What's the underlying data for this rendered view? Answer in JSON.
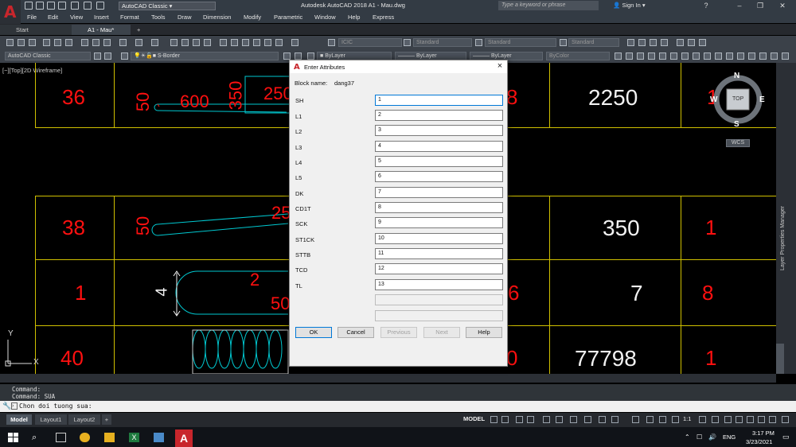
{
  "titlebar": {
    "workspace": "AutoCAD Classic",
    "title": "Autodesk AutoCAD 2018    A1 - Mau.dwg",
    "search_placeholder": "Type a keyword or phrase",
    "signin": "Sign In",
    "help": "?"
  },
  "menu": [
    "File",
    "Edit",
    "View",
    "Insert",
    "Format",
    "Tools",
    "Draw",
    "Dimension",
    "Modify",
    "Parametric",
    "Window",
    "Help",
    "Express"
  ],
  "tabs": {
    "start": "Start",
    "file": "A1 - Mau*"
  },
  "toolbar": {
    "text_style": "ICIC",
    "dim_style": "Standard",
    "table_style": "Standard",
    "mleader_style": "Standard",
    "workspace2": "AutoCAD Classic",
    "layer": "S-Border",
    "color": "ByLayer",
    "linetype": "ByLayer",
    "lineweight": "ByLayer",
    "plotstyle": "ByColor"
  },
  "viewport": {
    "label": "[−][Top][2D Wireframe]"
  },
  "viewcube": {
    "top": "TOP",
    "n": "N",
    "s": "S",
    "e": "E",
    "w": "W",
    "wcs": "WCS"
  },
  "ucs": {
    "y": "Y",
    "x": "X"
  },
  "drawing_text": {
    "r1": [
      "36",
      "50",
      "600",
      "350",
      "250",
      "8",
      "2250",
      "1"
    ],
    "r2": [
      "38",
      "50",
      "25",
      "350",
      "1"
    ],
    "r3": [
      "1",
      "4",
      "2",
      "50",
      "6",
      "7",
      "8"
    ],
    "r4": [
      "40",
      "0",
      "77798",
      "1"
    ]
  },
  "palette": {
    "label": "Layer Properties Manager"
  },
  "command": {
    "history1": "Command:",
    "history2": "Command: SUA",
    "prompt": "Chon doi tuong sua:"
  },
  "layout_tabs": [
    "Model",
    "Layout1",
    "Layout2"
  ],
  "status": {
    "model": "MODEL",
    "scale": "1:1"
  },
  "taskbar": {
    "lang": "ENG",
    "time": "3:17 PM",
    "date": "3/23/2021"
  },
  "dialog": {
    "title": "Enter Attributes",
    "close": "×",
    "block_name_label": "Block name:",
    "block_name": "dang37",
    "attributes": [
      {
        "label": "SH",
        "value": "1"
      },
      {
        "label": "L1",
        "value": "2"
      },
      {
        "label": "L2",
        "value": "3"
      },
      {
        "label": "L3",
        "value": "4"
      },
      {
        "label": "L4",
        "value": "5"
      },
      {
        "label": "L5",
        "value": "6"
      },
      {
        "label": "DK",
        "value": "7"
      },
      {
        "label": "CD1T",
        "value": "8"
      },
      {
        "label": "SCK",
        "value": "9"
      },
      {
        "label": "ST1CK",
        "value": "10"
      },
      {
        "label": "STTB",
        "value": "11"
      },
      {
        "label": "TCD",
        "value": "12"
      },
      {
        "label": "TL",
        "value": "13"
      }
    ],
    "buttons": {
      "ok": "OK",
      "cancel": "Cancel",
      "previous": "Previous",
      "next": "Next",
      "help": "Help"
    }
  },
  "colors": {
    "accent": "#c8262c",
    "cad_red": "#ff1010",
    "grid": "#d0c000",
    "spring": "#00c8d0"
  }
}
